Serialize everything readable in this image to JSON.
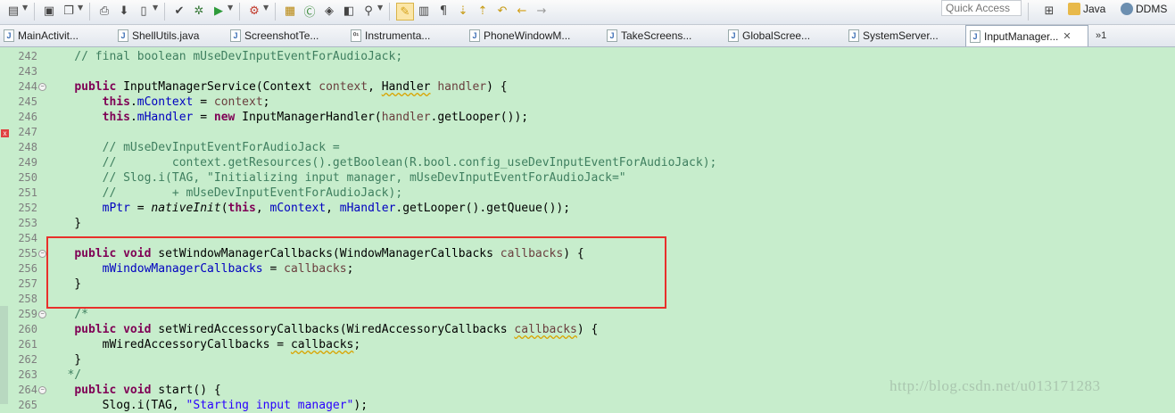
{
  "toolbar": {
    "quick_access_placeholder": "Quick Access",
    "perspectives": [
      {
        "label": "Java",
        "icon": "java-perspective-icon"
      },
      {
        "label": "DDMS",
        "icon": "ddms-perspective-icon"
      }
    ],
    "icons": [
      "new-icon",
      "save-icon",
      "save-all-icon",
      "print-icon",
      "sdk-manager-icon",
      "device-icon",
      "lint-icon",
      "debug-icon",
      "run-icon",
      "external-tools-icon",
      "new-package-icon",
      "new-class-icon",
      "open-type-icon",
      "open-task-icon",
      "search-icon",
      "toggle-mark-occurrences-icon",
      "toggle-block-selection-icon",
      "show-whitespace-icon",
      "next-annotation-icon",
      "previous-annotation-icon",
      "last-edit-location-icon",
      "back-icon",
      "forward-icon"
    ]
  },
  "tabs": [
    {
      "label": "MainActivit...",
      "icon": "java-file-icon",
      "active": false
    },
    {
      "label": "ShellUtils.java",
      "icon": "java-file-icon",
      "active": false
    },
    {
      "label": "ScreenshotTe...",
      "icon": "java-file-icon",
      "active": false
    },
    {
      "label": "Instrumenta...",
      "icon": "class-file-icon",
      "active": false
    },
    {
      "label": "PhoneWindowM...",
      "icon": "java-file-icon",
      "active": false
    },
    {
      "label": "TakeScreens...",
      "icon": "java-file-icon",
      "active": false
    },
    {
      "label": "GlobalScree...",
      "icon": "java-file-icon",
      "active": false
    },
    {
      "label": "SystemServer...",
      "icon": "java-file-icon",
      "active": false
    },
    {
      "label": "InputManager...",
      "icon": "java-file-icon",
      "active": true
    }
  ],
  "more_tabs_label": "»1",
  "code_lines": [
    {
      "num": "242",
      "fold": "",
      "tokens": [
        [
          "cm",
          "    // final boolean mUseDevInputEventForAudioJack;"
        ]
      ]
    },
    {
      "num": "243",
      "fold": "",
      "tokens": []
    },
    {
      "num": "244",
      "fold": "−",
      "tokens": [
        [
          "",
          "    "
        ],
        [
          "kw",
          "public"
        ],
        [
          "",
          " InputManagerService(Context "
        ],
        [
          "loc",
          "context"
        ],
        [
          "",
          ", "
        ],
        [
          "sq",
          "Handler"
        ],
        [
          "",
          " "
        ],
        [
          "loc",
          "handler"
        ],
        [
          "",
          ") {"
        ]
      ]
    },
    {
      "num": "245",
      "fold": "",
      "tokens": [
        [
          "",
          "        "
        ],
        [
          "kw",
          "this"
        ],
        [
          "",
          "."
        ],
        [
          "fld",
          "mContext"
        ],
        [
          "",
          " = "
        ],
        [
          "loc",
          "context"
        ],
        [
          "",
          ";"
        ]
      ]
    },
    {
      "num": "246",
      "fold": "",
      "tokens": [
        [
          "",
          "        "
        ],
        [
          "kw",
          "this"
        ],
        [
          "",
          "."
        ],
        [
          "fld",
          "mHandler"
        ],
        [
          "",
          " = "
        ],
        [
          "kw",
          "new"
        ],
        [
          "",
          " InputManagerHandler("
        ],
        [
          "loc",
          "handler"
        ],
        [
          "",
          ".getLooper());"
        ]
      ]
    },
    {
      "num": "247",
      "fold": "",
      "tokens": []
    },
    {
      "num": "248",
      "fold": "",
      "tokens": [
        [
          "cm",
          "        // mUseDevInputEventForAudioJack ="
        ]
      ]
    },
    {
      "num": "249",
      "fold": "",
      "tokens": [
        [
          "cm",
          "        //        context.getResources().getBoolean(R.bool.config_useDevInputEventForAudioJack);"
        ]
      ]
    },
    {
      "num": "250",
      "fold": "",
      "tokens": [
        [
          "cm",
          "        // Slog.i(TAG, \"Initializing input manager, mUseDevInputEventForAudioJack=\""
        ]
      ]
    },
    {
      "num": "251",
      "fold": "",
      "tokens": [
        [
          "cm",
          "        //        + mUseDevInputEventForAudioJack);"
        ]
      ]
    },
    {
      "num": "252",
      "fold": "",
      "tokens": [
        [
          "",
          "        "
        ],
        [
          "fld",
          "mPtr"
        ],
        [
          "",
          " = "
        ],
        [
          "it",
          "nativeInit"
        ],
        [
          "",
          "("
        ],
        [
          "kw",
          "this"
        ],
        [
          "",
          ", "
        ],
        [
          "fld",
          "mContext"
        ],
        [
          "",
          ", "
        ],
        [
          "fld",
          "mHandler"
        ],
        [
          "",
          ".getLooper().getQueue());"
        ]
      ]
    },
    {
      "num": "253",
      "fold": "",
      "tokens": [
        [
          "",
          "    }"
        ]
      ]
    },
    {
      "num": "254",
      "fold": "",
      "tokens": []
    },
    {
      "num": "255",
      "fold": "−",
      "tokens": [
        [
          "",
          "    "
        ],
        [
          "kw",
          "public"
        ],
        [
          "",
          " "
        ],
        [
          "kw",
          "void"
        ],
        [
          "",
          " setWindowManagerCallbacks(WindowManagerCallbacks "
        ],
        [
          "loc",
          "callbacks"
        ],
        [
          "",
          ") {"
        ]
      ]
    },
    {
      "num": "256",
      "fold": "",
      "tokens": [
        [
          "",
          "        "
        ],
        [
          "fld",
          "mWindowManagerCallbacks"
        ],
        [
          "",
          " = "
        ],
        [
          "loc",
          "callbacks"
        ],
        [
          "",
          ";"
        ]
      ]
    },
    {
      "num": "257",
      "fold": "",
      "tokens": [
        [
          "",
          "    }"
        ]
      ]
    },
    {
      "num": "258",
      "fold": "",
      "tokens": []
    },
    {
      "num": "259",
      "fold": "−",
      "tokens": [
        [
          "cm",
          "    /*"
        ]
      ]
    },
    {
      "num": "260",
      "fold": "",
      "tokens": [
        [
          "",
          "    "
        ],
        [
          "kw",
          "public"
        ],
        [
          "",
          " "
        ],
        [
          "kw",
          "void"
        ],
        [
          "",
          " setWiredAccessoryCallbacks(WiredAccessoryCallbacks "
        ],
        [
          "loc sq",
          "callbacks"
        ],
        [
          "",
          ") {"
        ]
      ]
    },
    {
      "num": "261",
      "fold": "",
      "tokens": [
        [
          "",
          "        mWiredAccessoryCallbacks = "
        ],
        [
          "sq",
          "callbacks"
        ],
        [
          "",
          ";"
        ]
      ]
    },
    {
      "num": "262",
      "fold": "",
      "tokens": [
        [
          "",
          "    }"
        ]
      ]
    },
    {
      "num": "263",
      "fold": "",
      "tokens": [
        [
          "cm",
          "   */"
        ]
      ]
    },
    {
      "num": "264",
      "fold": "−",
      "tokens": [
        [
          "",
          "    "
        ],
        [
          "kw",
          "public"
        ],
        [
          "",
          " "
        ],
        [
          "kw",
          "void"
        ],
        [
          "",
          " start() {"
        ]
      ]
    },
    {
      "num": "265",
      "fold": "",
      "tokens": [
        [
          "",
          "        Slog.i(TAG, "
        ],
        [
          "str",
          "\"Starting input manager\""
        ],
        [
          "",
          ");"
        ]
      ]
    }
  ],
  "watermark": "http://blog.csdn.net/u013171283",
  "colors": {
    "editor_background": "#c7edcc",
    "keyword": "#7f0055",
    "comment": "#3f7f5f",
    "field": "#0000c0",
    "local_variable": "#6a3e3e",
    "string": "#2a00ff",
    "highlight_box": "#e8302b"
  }
}
